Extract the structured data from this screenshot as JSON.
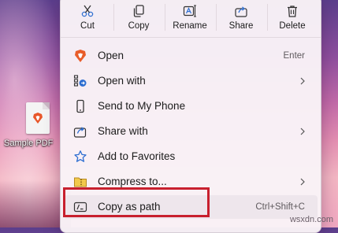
{
  "desktop": {
    "file_label": "Sample PDF"
  },
  "toolbar": {
    "cut": "Cut",
    "copy": "Copy",
    "rename": "Rename",
    "share": "Share",
    "delete": "Delete"
  },
  "menu": {
    "items": [
      {
        "label": "Open",
        "shortcut": "Enter"
      },
      {
        "label": "Open with"
      },
      {
        "label": "Send to My Phone"
      },
      {
        "label": "Share with"
      },
      {
        "label": "Add to Favorites"
      },
      {
        "label": "Compress to..."
      },
      {
        "label": "Copy as path",
        "shortcut": "Ctrl+Shift+C"
      }
    ]
  },
  "watermark": "wsxdn.com",
  "colors": {
    "accent": "#2f6fd1",
    "highlight_box": "#c8202e",
    "brand": "#e85d2a"
  }
}
